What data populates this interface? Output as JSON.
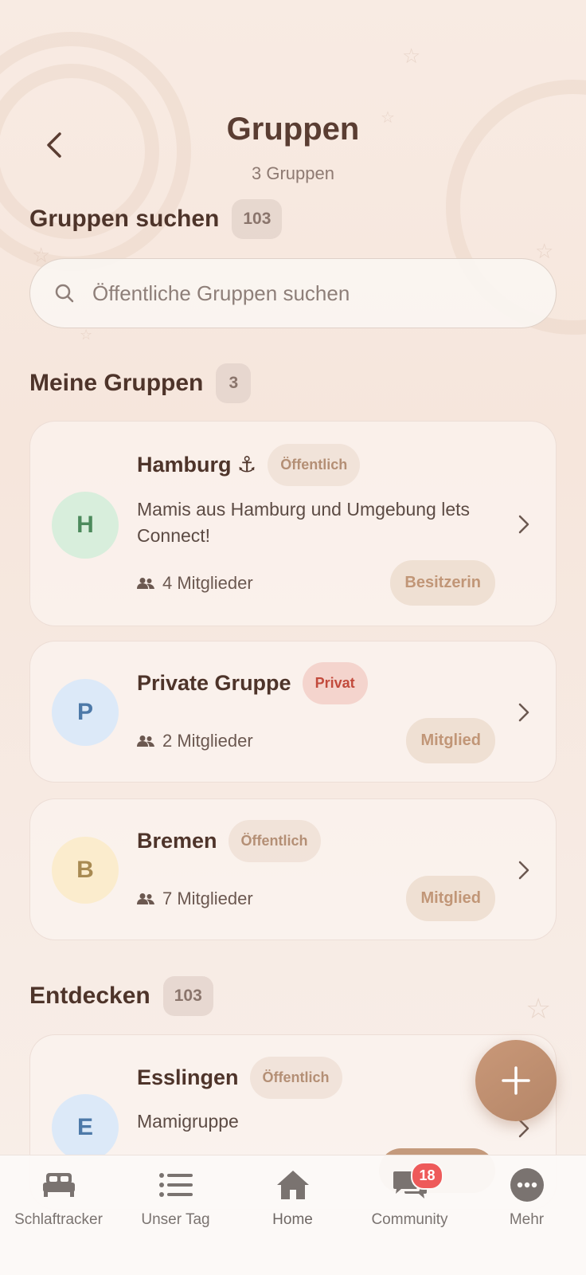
{
  "header": {
    "title": "Gruppen",
    "subtitle": "3 Gruppen"
  },
  "search_section": {
    "title": "Gruppen suchen",
    "count": "103",
    "placeholder": "Öffentliche Gruppen suchen"
  },
  "my_groups": {
    "title": "Meine Gruppen",
    "count": "3",
    "items": [
      {
        "initial": "H",
        "name": "Hamburg ⚓",
        "visibility": "Öffentlich",
        "description": "Mamis aus Hamburg und Umgebung lets Connect!",
        "members": "4 Mitglieder",
        "role": "Besitzerin",
        "avatar_bg": "#d8eedc",
        "avatar_color": "#4c8a5c"
      },
      {
        "initial": "P",
        "name": "Private Gruppe",
        "visibility": "Privat",
        "description": "",
        "members": "2 Mitglieder",
        "role": "Mitglied",
        "avatar_bg": "#dce9f8",
        "avatar_color": "#4d79a8"
      },
      {
        "initial": "B",
        "name": "Bremen",
        "visibility": "Öffentlich",
        "description": "",
        "members": "7 Mitglieder",
        "role": "Mitglied",
        "avatar_bg": "#fbeccd",
        "avatar_color": "#a88a52"
      }
    ]
  },
  "discover": {
    "title": "Entdecken",
    "count": "103",
    "items": [
      {
        "initial": "E",
        "name": "Esslingen",
        "visibility": "Öffentlich",
        "description": "Mamigruppe",
        "avatar_bg": "#dce9f8",
        "avatar_color": "#4d79a8"
      }
    ]
  },
  "tabbar": {
    "items": [
      {
        "label": "Schlaftracker",
        "icon": "bed-icon"
      },
      {
        "label": "Unser Tag",
        "icon": "list-icon"
      },
      {
        "label": "Home",
        "icon": "home-icon"
      },
      {
        "label": "Community",
        "icon": "chat-bubbles-icon",
        "badge": "18"
      },
      {
        "label": "Mehr",
        "icon": "more-dots-icon"
      }
    ]
  },
  "colors": {
    "accent": "#b98a6b",
    "title": "#5a3d32",
    "badge_red": "#ee5a5a"
  }
}
